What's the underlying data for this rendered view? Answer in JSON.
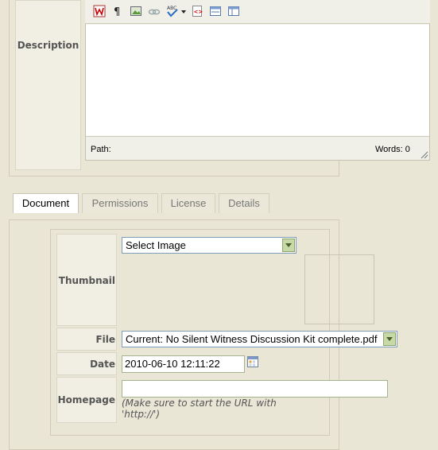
{
  "description": {
    "label": "Description",
    "editor": {
      "toolbar": [
        {
          "icon": "paste-word-icon"
        },
        {
          "icon": "paragraph-icon"
        },
        {
          "icon": "insert-image-icon"
        },
        {
          "icon": "insert-link-icon"
        },
        {
          "icon": "spellcheck-icon"
        },
        {
          "icon": "dropdown-arrow-icon"
        },
        {
          "icon": "html-source-icon"
        },
        {
          "icon": "horizontal-rule-icon"
        },
        {
          "icon": "template-icon"
        }
      ],
      "path_label": "Path:",
      "words_label": "Words: 0"
    }
  },
  "tabs": [
    {
      "label": "Document",
      "active": true
    },
    {
      "label": "Permissions",
      "active": false
    },
    {
      "label": "License",
      "active": false
    },
    {
      "label": "Details",
      "active": false
    }
  ],
  "form": {
    "thumbnail": {
      "label": "Thumbnail",
      "value": "Select Image"
    },
    "file": {
      "label": "File",
      "value": "Current: No Silent Witness Discussion Kit complete.pdf"
    },
    "date": {
      "label": "Date",
      "value": "2010-06-10 12:11:22"
    },
    "homepage": {
      "label": "Homepage",
      "value": "",
      "hint": "(Make sure to start the URL with 'http://')"
    }
  }
}
